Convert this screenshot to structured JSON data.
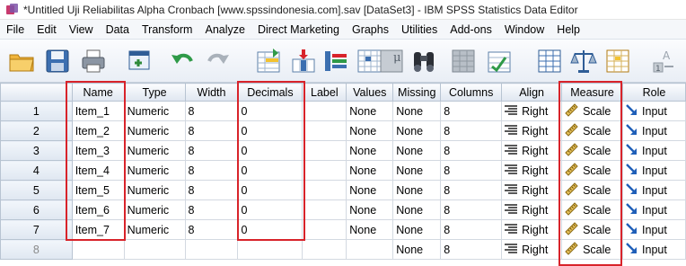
{
  "window": {
    "title": "*Untitled Uji Reliabilitas Alpha Cronbach [www.spssindonesia.com].sav [DataSet3] - IBM SPSS Statistics Data Editor"
  },
  "menu": [
    "File",
    "Edit",
    "View",
    "Data",
    "Transform",
    "Analyze",
    "Direct Marketing",
    "Graphs",
    "Utilities",
    "Add-ons",
    "Window",
    "Help"
  ],
  "toolbar": {
    "icons": [
      "open-folder-icon",
      "save-icon",
      "print-icon",
      "recall-dialog-icon",
      "undo-icon",
      "redo-icon",
      "go-to-case-icon",
      "go-to-variable-icon",
      "variables-icon",
      "run-descriptive-icon",
      "find-icon",
      "insert-cases-icon",
      "insert-variable-icon",
      "split-file-icon",
      "weight-cases-icon",
      "select-cases-icon",
      "value-labels-icon"
    ]
  },
  "grid": {
    "columns": [
      "Name",
      "Type",
      "Width",
      "Decimals",
      "Label",
      "Values",
      "Missing",
      "Columns",
      "Align",
      "Measure",
      "Role"
    ],
    "rows": [
      {
        "num": "1",
        "name": "Item_1",
        "type": "Numeric",
        "width": "8",
        "decimals": "0",
        "label": "",
        "values": "None",
        "missing": "None",
        "columns": "8",
        "align": "Right",
        "measure": "Scale",
        "role": "Input"
      },
      {
        "num": "2",
        "name": "Item_2",
        "type": "Numeric",
        "width": "8",
        "decimals": "0",
        "label": "",
        "values": "None",
        "missing": "None",
        "columns": "8",
        "align": "Right",
        "measure": "Scale",
        "role": "Input"
      },
      {
        "num": "3",
        "name": "Item_3",
        "type": "Numeric",
        "width": "8",
        "decimals": "0",
        "label": "",
        "values": "None",
        "missing": "None",
        "columns": "8",
        "align": "Right",
        "measure": "Scale",
        "role": "Input"
      },
      {
        "num": "4",
        "name": "Item_4",
        "type": "Numeric",
        "width": "8",
        "decimals": "0",
        "label": "",
        "values": "None",
        "missing": "None",
        "columns": "8",
        "align": "Right",
        "measure": "Scale",
        "role": "Input"
      },
      {
        "num": "5",
        "name": "Item_5",
        "type": "Numeric",
        "width": "8",
        "decimals": "0",
        "label": "",
        "values": "None",
        "missing": "None",
        "columns": "8",
        "align": "Right",
        "measure": "Scale",
        "role": "Input"
      },
      {
        "num": "6",
        "name": "Item_6",
        "type": "Numeric",
        "width": "8",
        "decimals": "0",
        "label": "",
        "values": "None",
        "missing": "None",
        "columns": "8",
        "align": "Right",
        "measure": "Scale",
        "role": "Input"
      },
      {
        "num": "7",
        "name": "Item_7",
        "type": "Numeric",
        "width": "8",
        "decimals": "0",
        "label": "",
        "values": "None",
        "missing": "None",
        "columns": "8",
        "align": "Right",
        "measure": "Scale",
        "role": "Input"
      },
      {
        "num": "8",
        "name": "",
        "type": "",
        "width": "",
        "decimals": "",
        "label": "",
        "values": "",
        "missing": "None",
        "columns": "8",
        "align": "Right",
        "measure": "Scale",
        "role": "Input"
      }
    ]
  },
  "colors": {
    "highlight": "#d8232a",
    "role_arrow": "#1f5fb8"
  }
}
